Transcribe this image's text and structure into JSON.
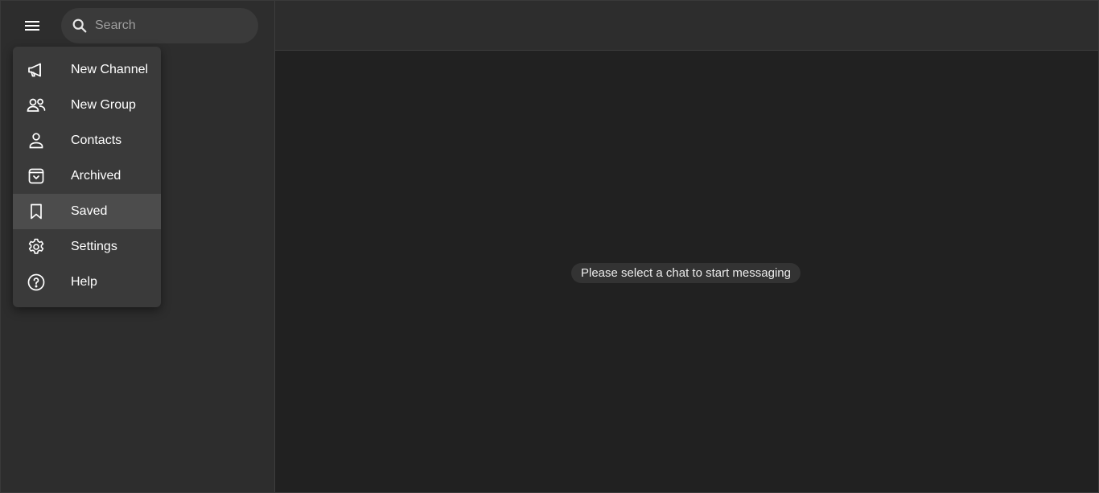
{
  "search": {
    "placeholder": "Search"
  },
  "menu": {
    "items": [
      {
        "label": "New Channel",
        "icon": "megaphone-icon"
      },
      {
        "label": "New Group",
        "icon": "group-icon"
      },
      {
        "label": "Contacts",
        "icon": "person-icon"
      },
      {
        "label": "Archived",
        "icon": "archive-icon"
      },
      {
        "label": "Saved",
        "icon": "bookmark-icon",
        "active": true
      },
      {
        "label": "Settings",
        "icon": "gear-icon"
      },
      {
        "label": "Help",
        "icon": "help-icon"
      }
    ]
  },
  "main": {
    "empty_message": "Please select a chat to start messaging"
  },
  "colors": {
    "sidebar_bg": "#2d2d2d",
    "main_bg": "#212121",
    "menu_bg": "#3a3a3a",
    "menu_active_bg": "#4c4c4c"
  }
}
